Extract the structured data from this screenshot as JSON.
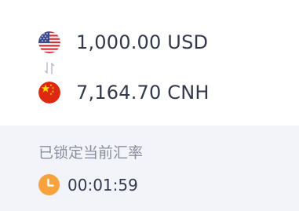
{
  "conversion": {
    "from": {
      "amount": "1,000.00 USD",
      "flag_icon": "us-flag-icon"
    },
    "to": {
      "amount": "7,164.70 CNH",
      "flag_icon": "cn-flag-icon"
    },
    "swap_icon": "swap-arrows-icon"
  },
  "rate_lock": {
    "label": "已锁定当前汇率",
    "countdown": "00:01:59",
    "timer_icon": "clock-icon",
    "timer_color": "#f7a23b"
  },
  "colors": {
    "amount_text": "#33394a",
    "label_text": "#8a8f9c",
    "lock_panel_bg": "#f3f4f9"
  }
}
